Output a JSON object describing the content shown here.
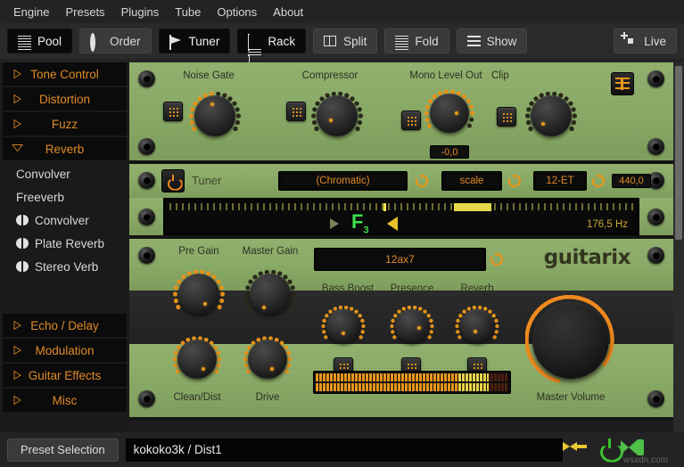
{
  "menu": {
    "items": [
      "Engine",
      "Presets",
      "Plugins",
      "Tube",
      "Options",
      "About"
    ]
  },
  "toolbar": {
    "buttons": [
      {
        "label": "Pool",
        "icon": "list-icon",
        "active": true
      },
      {
        "label": "Order",
        "icon": "gear-icon",
        "active": false
      },
      {
        "label": "Tuner",
        "icon": "tuner-icon",
        "active": true
      },
      {
        "label": "Rack",
        "icon": "rack-icon",
        "active": true
      },
      {
        "label": "Split",
        "icon": "split-icon",
        "active": false
      },
      {
        "label": "Fold",
        "icon": "fold-icon",
        "active": false
      },
      {
        "label": "Show",
        "icon": "show-icon",
        "active": false
      }
    ],
    "live": {
      "label": "Live",
      "icon": "fullscreen-icon"
    }
  },
  "sidebar": {
    "categories_top": [
      {
        "label": "Tone Control",
        "expanded": false
      },
      {
        "label": "Distortion",
        "expanded": false
      },
      {
        "label": "Fuzz",
        "expanded": false
      },
      {
        "label": "Reverb",
        "expanded": true
      }
    ],
    "plugins": [
      {
        "label": "Convolver",
        "stereo": false
      },
      {
        "label": "Freeverb",
        "stereo": false
      },
      {
        "label": "Convolver",
        "stereo": true
      },
      {
        "label": "Plate Reverb",
        "stereo": true
      },
      {
        "label": "Stereo Verb",
        "stereo": true
      }
    ],
    "categories_bottom": [
      {
        "label": "Echo / Delay",
        "expanded": false
      },
      {
        "label": "Modulation",
        "expanded": false
      },
      {
        "label": "Guitar Effects",
        "expanded": false
      },
      {
        "label": "Misc",
        "expanded": false
      }
    ]
  },
  "rack": {
    "amp_io": {
      "knobs": [
        {
          "label": "Noise Gate",
          "angle": -42
        },
        {
          "label": "Compressor",
          "angle": -8
        },
        {
          "label": "Mono Level Out",
          "angle": 20
        },
        {
          "label": "Clip",
          "angle": -28
        }
      ],
      "mono_level_value": "-0,0"
    },
    "tuner": {
      "title": "Tuner",
      "mode": "(Chromatic)",
      "scale": "scale",
      "temperament": "12-ET",
      "reference": "440,0",
      "note": "F",
      "octave": "3",
      "frequency": "176,5 Hz"
    },
    "amp": {
      "brand": "guitarix",
      "tube": "12ax7",
      "knobs_top": [
        {
          "label": "Pre Gain",
          "angle": 20
        },
        {
          "label": "Master Gain",
          "angle": -10
        }
      ],
      "knobs_mid": [
        {
          "label": "Bass Boost",
          "angle": 0
        },
        {
          "label": "Presence",
          "angle": 35
        },
        {
          "label": "Reverb",
          "angle": -5
        }
      ],
      "knobs_bottom": [
        {
          "label": "Clean/Dist",
          "angle": 22
        },
        {
          "label": "Drive",
          "angle": 18
        }
      ],
      "master_volume_label": "Master Volume"
    }
  },
  "bottom": {
    "preset_button": "Preset Selection",
    "preset_value": "kokoko3k / Dist1",
    "icons": [
      "prev-next-icon",
      "power-icon",
      "bypass-icon",
      "preset-list-icon"
    ],
    "watermark": "wsxdn.com"
  },
  "colors": {
    "accent_orange": "#e08a27",
    "panel_green": "#8aab66",
    "note_green": "#3ee04a",
    "power_green": "#3bc02f"
  }
}
